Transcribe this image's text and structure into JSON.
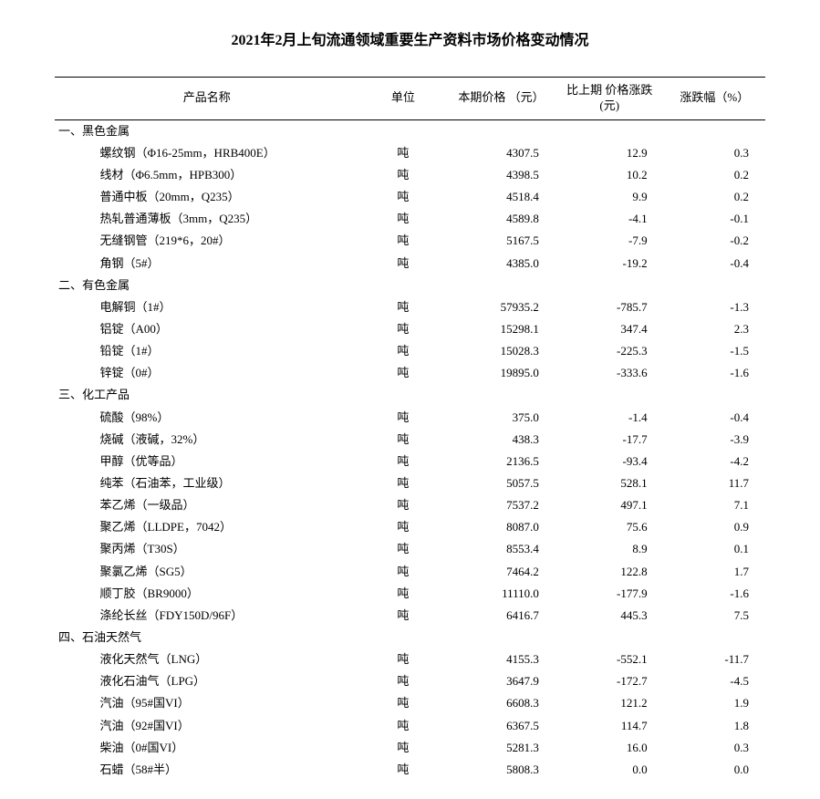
{
  "title": "2021年2月上旬流通领域重要生产资料市场价格变动情况",
  "columns": {
    "name": "产品名称",
    "unit": "单位",
    "price": "本期价格\n（元）",
    "diff": "比上期\n价格涨跌(元)",
    "pct": "涨跌幅（%）"
  },
  "sections": [
    {
      "heading": "一、黑色金属",
      "rows": [
        {
          "name": "螺纹钢（Φ16-25mm，HRB400E）",
          "unit": "吨",
          "price": "4307.5",
          "diff": "12.9",
          "pct": "0.3"
        },
        {
          "name": "线材（Φ6.5mm，HPB300）",
          "unit": "吨",
          "price": "4398.5",
          "diff": "10.2",
          "pct": "0.2"
        },
        {
          "name": "普通中板（20mm，Q235）",
          "unit": "吨",
          "price": "4518.4",
          "diff": "9.9",
          "pct": "0.2"
        },
        {
          "name": "热轧普通薄板（3mm，Q235）",
          "unit": "吨",
          "price": "4589.8",
          "diff": "-4.1",
          "pct": "-0.1"
        },
        {
          "name": "无缝钢管（219*6，20#）",
          "unit": "吨",
          "price": "5167.5",
          "diff": "-7.9",
          "pct": "-0.2"
        },
        {
          "name": "角钢（5#）",
          "unit": "吨",
          "price": "4385.0",
          "diff": "-19.2",
          "pct": "-0.4"
        }
      ]
    },
    {
      "heading": "二、有色金属",
      "rows": [
        {
          "name": "电解铜（1#）",
          "unit": "吨",
          "price": "57935.2",
          "diff": "-785.7",
          "pct": "-1.3"
        },
        {
          "name": "铝锭（A00）",
          "unit": "吨",
          "price": "15298.1",
          "diff": "347.4",
          "pct": "2.3"
        },
        {
          "name": "铅锭（1#）",
          "unit": "吨",
          "price": "15028.3",
          "diff": "-225.3",
          "pct": "-1.5"
        },
        {
          "name": "锌锭（0#）",
          "unit": "吨",
          "price": "19895.0",
          "diff": "-333.6",
          "pct": "-1.6"
        }
      ]
    },
    {
      "heading": "三、化工产品",
      "rows": [
        {
          "name": "硫酸（98%）",
          "unit": "吨",
          "price": "375.0",
          "diff": "-1.4",
          "pct": "-0.4"
        },
        {
          "name": "烧碱（液碱，32%）",
          "unit": "吨",
          "price": "438.3",
          "diff": "-17.7",
          "pct": "-3.9"
        },
        {
          "name": "甲醇（优等品）",
          "unit": "吨",
          "price": "2136.5",
          "diff": "-93.4",
          "pct": "-4.2"
        },
        {
          "name": "纯苯（石油苯，工业级）",
          "unit": "吨",
          "price": "5057.5",
          "diff": "528.1",
          "pct": "11.7"
        },
        {
          "name": "苯乙烯（一级品）",
          "unit": "吨",
          "price": "7537.2",
          "diff": "497.1",
          "pct": "7.1"
        },
        {
          "name": "聚乙烯（LLDPE，7042）",
          "unit": "吨",
          "price": "8087.0",
          "diff": "75.6",
          "pct": "0.9"
        },
        {
          "name": "聚丙烯（T30S）",
          "unit": "吨",
          "price": "8553.4",
          "diff": "8.9",
          "pct": "0.1"
        },
        {
          "name": "聚氯乙烯（SG5）",
          "unit": "吨",
          "price": "7464.2",
          "diff": "122.8",
          "pct": "1.7"
        },
        {
          "name": "顺丁胶（BR9000）",
          "unit": "吨",
          "price": "11110.0",
          "diff": "-177.9",
          "pct": "-1.6"
        },
        {
          "name": "涤纶长丝（FDY150D/96F）",
          "unit": "吨",
          "price": "6416.7",
          "diff": "445.3",
          "pct": "7.5"
        }
      ]
    },
    {
      "heading": "四、石油天然气",
      "rows": [
        {
          "name": "液化天然气（LNG）",
          "unit": "吨",
          "price": "4155.3",
          "diff": "-552.1",
          "pct": "-11.7"
        },
        {
          "name": "液化石油气（LPG）",
          "unit": "吨",
          "price": "3647.9",
          "diff": "-172.7",
          "pct": "-4.5"
        },
        {
          "name": "汽油（95#国VI）",
          "unit": "吨",
          "price": "6608.3",
          "diff": "121.2",
          "pct": "1.9"
        },
        {
          "name": "汽油（92#国VI）",
          "unit": "吨",
          "price": "6367.5",
          "diff": "114.7",
          "pct": "1.8"
        },
        {
          "name": "柴油（0#国VI）",
          "unit": "吨",
          "price": "5281.3",
          "diff": "16.0",
          "pct": "0.3"
        },
        {
          "name": "石蜡（58#半）",
          "unit": "吨",
          "price": "5808.3",
          "diff": "0.0",
          "pct": "0.0"
        }
      ]
    }
  ]
}
